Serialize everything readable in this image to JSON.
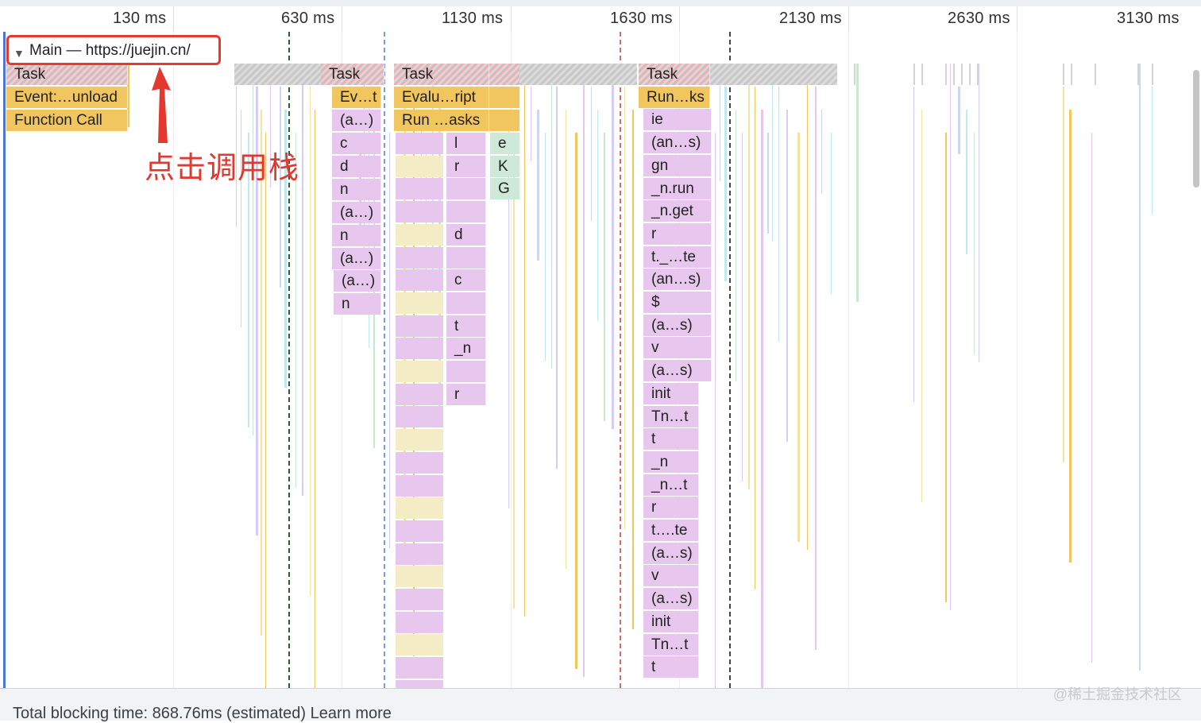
{
  "ruler": {
    "ticks": [
      "130 ms",
      "630 ms",
      "1130 ms",
      "1630 ms",
      "2130 ms",
      "2630 ms",
      "3130 ms"
    ],
    "more": "..."
  },
  "main_track": {
    "title": "Main — https://juejin.cn/",
    "expanded_glyph": "▼"
  },
  "annotation": {
    "text": "点击调用栈",
    "color": "#e3382d"
  },
  "flame": {
    "group1": [
      "Task",
      "Event:…unload",
      "Function Call"
    ],
    "group2": [
      "Task",
      "Ev…t",
      "(a…)",
      "c",
      "d",
      "n",
      "(a…)",
      "n",
      "(a…)",
      "(a…)",
      "n"
    ],
    "group3_top": [
      "Task",
      "Evalu…ript",
      "Run …asks"
    ],
    "group3_colA": [
      "l",
      "r",
      "",
      "",
      "d",
      "",
      "c",
      "",
      "t",
      "_n",
      "",
      "r"
    ],
    "group3_colB": [
      "e",
      "K",
      "G"
    ],
    "group4": [
      "Task",
      "Run…ks",
      "ie",
      "(an…s)",
      "gn",
      "_n.run",
      "_n.get",
      "r",
      "t._…te",
      "(an…s)",
      "$",
      "(a…s)",
      "v",
      "(a…s)",
      "init",
      "Tn…t",
      "t",
      "_n",
      "_n…t",
      "r",
      "t….te",
      "(a…s)",
      "v",
      "(a…s)",
      "init",
      "Tn…t",
      "t"
    ]
  },
  "footer": {
    "text": "Total blocking time: 868.76ms (estimated)  Learn more"
  },
  "watermark": "@稀土掘金技术社区",
  "colors": {
    "task": "#d0d0d0",
    "scripting": "#f1c65f",
    "js_frame": "#e8c7ee",
    "highlight": "#e33b2e",
    "track_accent": "#4a78d1"
  }
}
